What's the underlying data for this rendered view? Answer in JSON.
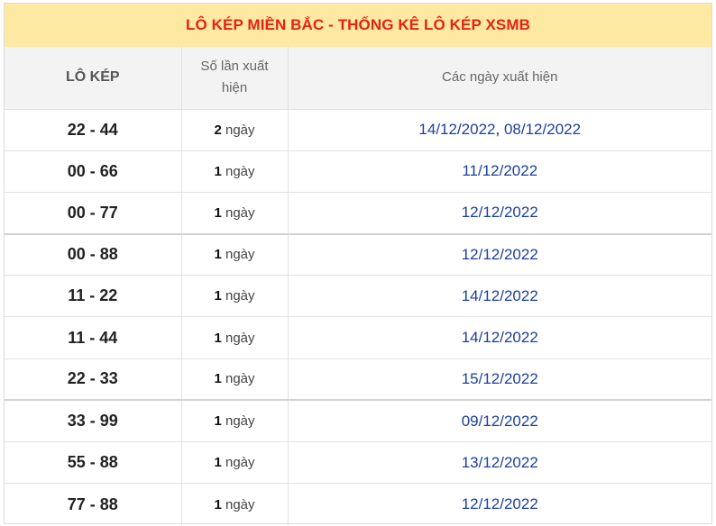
{
  "title": "LÔ KÉP MIỀN BẮC - THỐNG KÊ LÔ KÉP XSMB",
  "columns": {
    "pair": "LÔ KÉP",
    "count": "Số lần xuất hiện",
    "dates": "Các ngày xuất hiện"
  },
  "count_unit": "ngày",
  "date_separator": ", ",
  "colors": {
    "title_bg": "#fde9a2",
    "title_text": "#e62117",
    "link": "#1b3fa0",
    "header_bg": "#f3f3f3"
  },
  "rows": [
    {
      "pair": "22 - 44",
      "count": "2",
      "dates": [
        "14/12/2022",
        "08/12/2022"
      ]
    },
    {
      "pair": "00 - 66",
      "count": "1",
      "dates": [
        "11/12/2022"
      ]
    },
    {
      "pair": "00 - 77",
      "count": "1",
      "dates": [
        "12/12/2022"
      ]
    },
    {
      "pair": "00 - 88",
      "count": "1",
      "dates": [
        "12/12/2022"
      ]
    },
    {
      "pair": "11 - 22",
      "count": "1",
      "dates": [
        "14/12/2022"
      ]
    },
    {
      "pair": "11 - 44",
      "count": "1",
      "dates": [
        "14/12/2022"
      ]
    },
    {
      "pair": "22 - 33",
      "count": "1",
      "dates": [
        "15/12/2022"
      ]
    },
    {
      "pair": "33 - 99",
      "count": "1",
      "dates": [
        "09/12/2022"
      ]
    },
    {
      "pair": "55 - 88",
      "count": "1",
      "dates": [
        "13/12/2022"
      ]
    },
    {
      "pair": "77 - 88",
      "count": "1",
      "dates": [
        "12/12/2022"
      ]
    }
  ]
}
